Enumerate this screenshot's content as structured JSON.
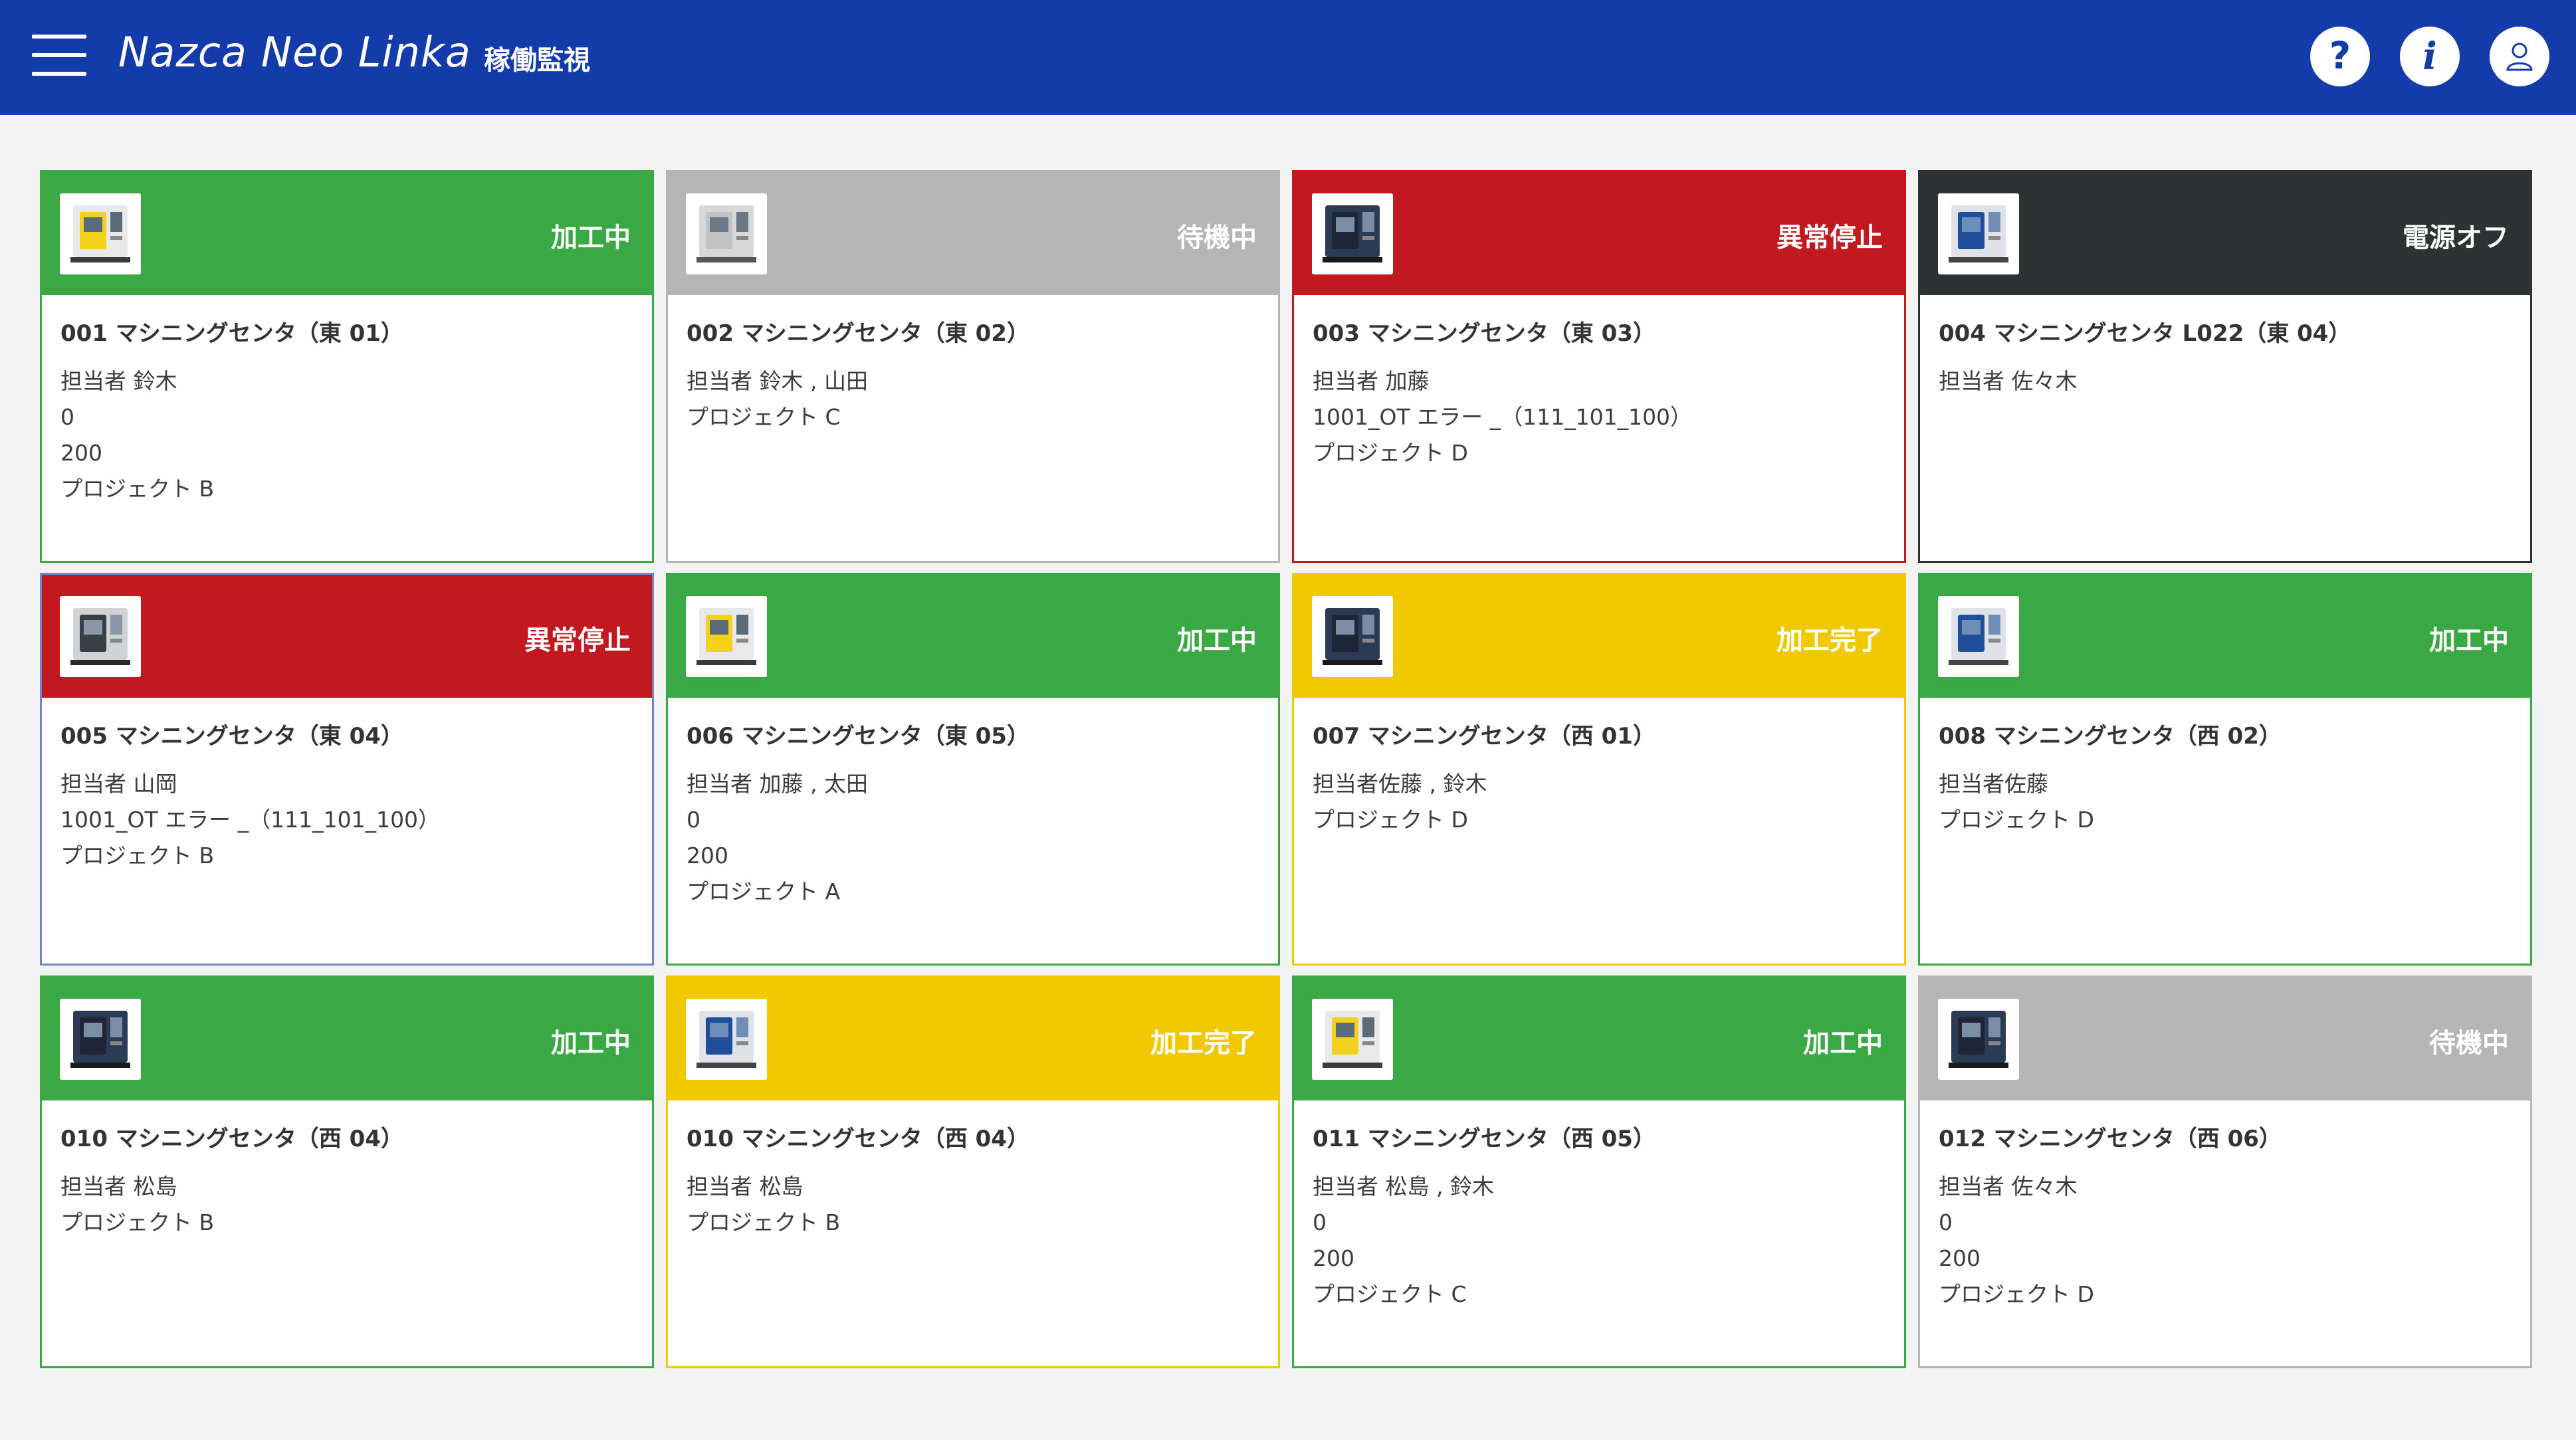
{
  "header": {
    "brand": "Nazca Neo Linka",
    "title": "稼働監視",
    "help_label": "?",
    "info_label": "i"
  },
  "colors": {
    "header": "#133caa",
    "running": "#3aa844",
    "standby": "#b5b5b5",
    "error": "#c2181f",
    "off": "#2d3233",
    "done": "#f1c900"
  },
  "cards": [
    {
      "status": "加工中",
      "color": "#3aa844",
      "border": "#3aa844",
      "machine": "yellow",
      "name": "001 マシニングセンタ（東 01）",
      "lines": [
        "担当者 鈴木",
        "0",
        "200",
        "プロジェクト B"
      ]
    },
    {
      "status": "待機中",
      "color": "#b5b5b5",
      "border": "#b5b5b5",
      "machine": "grey",
      "name": "002 マシニングセンタ（東 02）",
      "lines": [
        "担当者 鈴木 , 山田",
        "プロジェクト C"
      ]
    },
    {
      "status": "異常停止",
      "color": "#c2181f",
      "border": "#c2181f",
      "machine": "dark",
      "name": "003 マシニングセンタ（東 03）",
      "lines": [
        "担当者 加藤",
        "1001_OT エラー _（111_101_100）",
        "プロジェクト D"
      ]
    },
    {
      "status": "電源オフ",
      "color": "#2d3233",
      "border": "#2d3233",
      "machine": "blue",
      "name": "004 マシニングセンタ L022（東 04）",
      "lines": [
        "担当者 佐々木"
      ]
    },
    {
      "status": "異常停止",
      "color": "#c2181f",
      "border": "#6b86c9",
      "machine": "lathe",
      "name": "005 マシニングセンタ（東 04）",
      "lines": [
        "担当者 山岡",
        "1001_OT エラー _（111_101_100）",
        "プロジェクト B"
      ]
    },
    {
      "status": "加工中",
      "color": "#3aa844",
      "border": "#3aa844",
      "machine": "yellow",
      "name": "006 マシニングセンタ（東 05）",
      "lines": [
        "担当者 加藤 , 太田",
        "0",
        "200",
        "プロジェクト A"
      ]
    },
    {
      "status": "加工完了",
      "color": "#f1c900",
      "border": "#f1c900",
      "machine": "dark",
      "name": "007 マシニングセンタ（西 01）",
      "lines": [
        "担当者佐藤 , 鈴木",
        "プロジェクト D"
      ]
    },
    {
      "status": "加工中",
      "color": "#3aa844",
      "border": "#3aa844",
      "machine": "blue",
      "name": "008 マシニングセンタ（西 02）",
      "lines": [
        "担当者佐藤",
        "プロジェクト D"
      ]
    },
    {
      "status": "加工中",
      "color": "#3aa844",
      "border": "#3aa844",
      "machine": "dark",
      "name": "010 マシニングセンタ（西 04）",
      "lines": [
        "担当者 松島",
        "プロジェクト B"
      ]
    },
    {
      "status": "加工完了",
      "color": "#f1c900",
      "border": "#f1c900",
      "machine": "blue",
      "name": "010 マシニングセンタ（西 04）",
      "lines": [
        "担当者 松島",
        "プロジェクト B"
      ]
    },
    {
      "status": "加工中",
      "color": "#3aa844",
      "border": "#3aa844",
      "machine": "yellow",
      "name": "011 マシニングセンタ（西 05）",
      "lines": [
        "担当者 松島 , 鈴木",
        "0",
        "200",
        "プロジェクト C"
      ]
    },
    {
      "status": "待機中",
      "color": "#b5b5b5",
      "border": "#b5b5b5",
      "machine": "dark",
      "name": "012 マシニングセンタ（西 06）",
      "lines": [
        "担当者 佐々木",
        "0",
        "200",
        "プロジェクト D"
      ]
    }
  ]
}
